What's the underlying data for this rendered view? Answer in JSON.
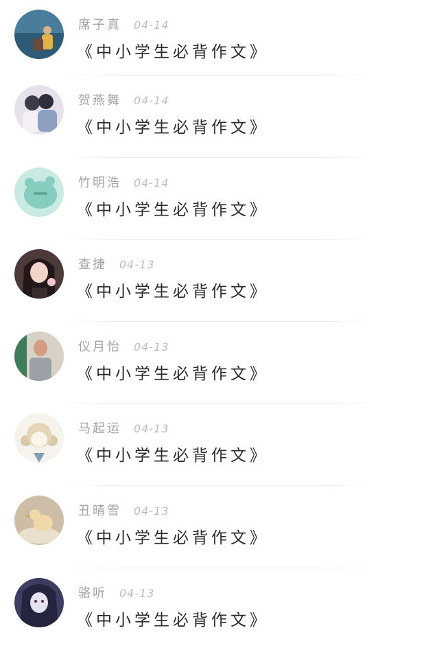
{
  "comments": [
    {
      "name": "席子真",
      "date": "04-14",
      "title": "《中小学生必背作文》",
      "avatar": "beach-couple-avatar",
      "colors": [
        "#3b6a8a",
        "#d9a54a"
      ]
    },
    {
      "name": "贺燕舞",
      "date": "04-14",
      "title": "《中小学生必背作文》",
      "avatar": "couple-photo-avatar",
      "colors": [
        "#7d8fb3",
        "#e9e4ee"
      ]
    },
    {
      "name": "竹明浩",
      "date": "04-14",
      "title": "《中小学生必背作文》",
      "avatar": "mint-bear-avatar",
      "colors": [
        "#a9dcd3",
        "#7fc8bb"
      ]
    },
    {
      "name": "查捷",
      "date": "04-13",
      "title": "《中小学生必背作文》",
      "avatar": "girl-icecream-avatar",
      "colors": [
        "#3a2c2a",
        "#f0d0c8"
      ]
    },
    {
      "name": "仪月怡",
      "date": "04-13",
      "title": "《中小学生必背作文》",
      "avatar": "old-man-avatar",
      "colors": [
        "#d9d3c8",
        "#8a8f93"
      ]
    },
    {
      "name": "马起运",
      "date": "04-13",
      "title": "《中小学生必背作文》",
      "avatar": "anime-girl-avatar",
      "colors": [
        "#f3efe6",
        "#d8c7a8"
      ]
    },
    {
      "name": "丑晴雪",
      "date": "04-13",
      "title": "《中小学生必背作文》",
      "avatar": "duckling-avatar",
      "colors": [
        "#c9b7a0",
        "#f2e7d6"
      ]
    },
    {
      "name": "骆听",
      "date": "04-13",
      "title": "《中小学生必背作文》",
      "avatar": "dark-anime-avatar",
      "colors": [
        "#3a3a5c",
        "#d9d6e8"
      ]
    }
  ]
}
